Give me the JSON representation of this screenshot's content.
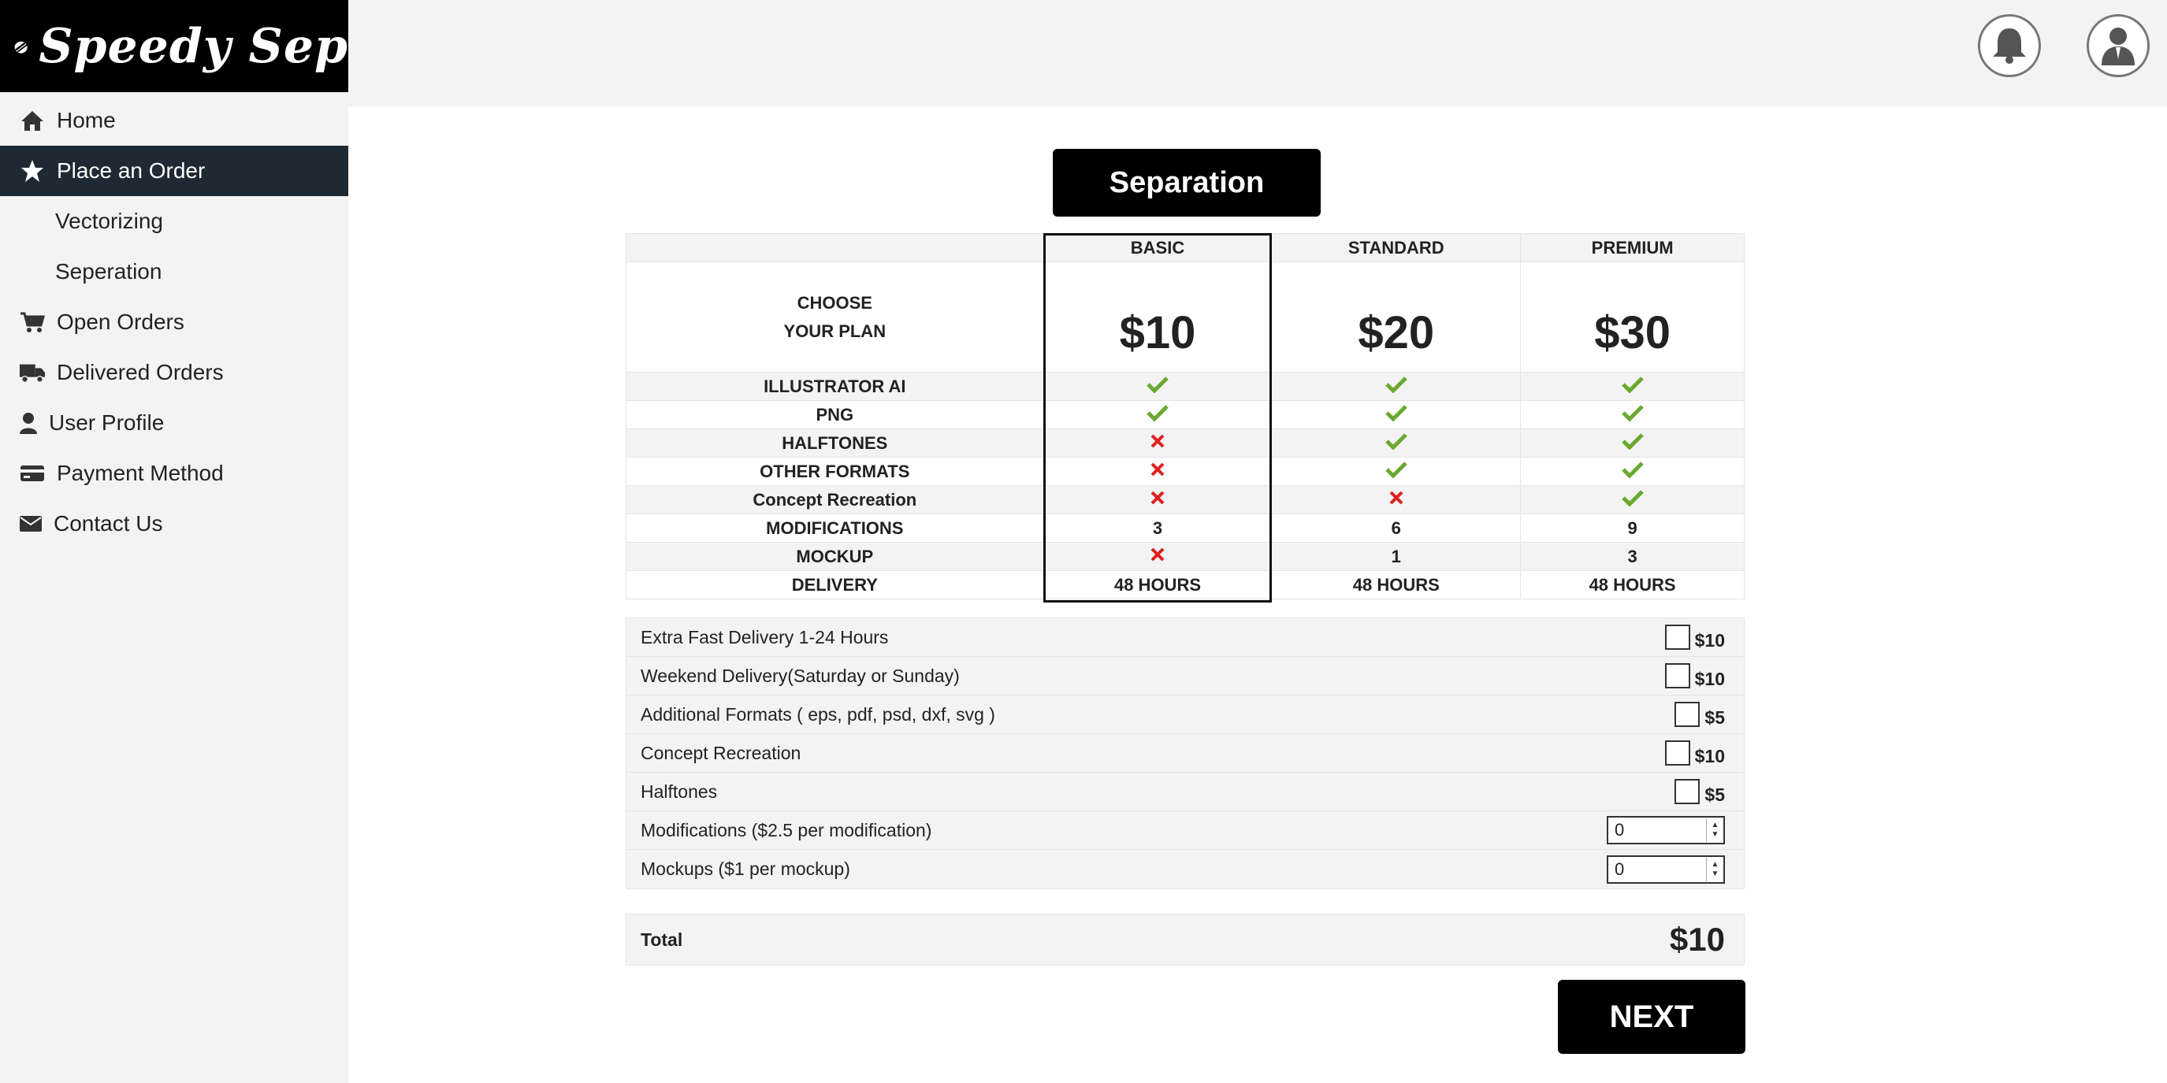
{
  "brand": {
    "name": "Speedy Sep"
  },
  "sidebar": {
    "items": [
      {
        "label": "Home",
        "icon": "home-icon"
      },
      {
        "label": "Place an Order",
        "icon": "star-icon",
        "active": true
      },
      {
        "label": "Vectorizing",
        "sub": true
      },
      {
        "label": "Seperation",
        "sub": true
      },
      {
        "label": "Open Orders",
        "icon": "cart-icon"
      },
      {
        "label": "Delivered Orders",
        "icon": "truck-icon"
      },
      {
        "label": "User Profile",
        "icon": "user-icon"
      },
      {
        "label": "Payment Method",
        "icon": "credit-card-icon"
      },
      {
        "label": "Contact Us",
        "icon": "envelope-icon"
      }
    ]
  },
  "header": {
    "notification_icon": "bell-icon",
    "profile_icon": "user-avatar-icon"
  },
  "page": {
    "title": "Separation"
  },
  "plans": {
    "choose_line1": "CHOOSE",
    "choose_line2": "YOUR PLAN",
    "columns": [
      {
        "name": "BASIC",
        "price": "$10"
      },
      {
        "name": "STANDARD",
        "price": "$20"
      },
      {
        "name": "PREMIUM",
        "price": "$30"
      }
    ],
    "features": [
      {
        "label": "ILLUSTRATOR AI",
        "values": [
          "check",
          "check",
          "check"
        ]
      },
      {
        "label": "PNG",
        "values": [
          "check",
          "check",
          "check"
        ]
      },
      {
        "label": "HALFTONES",
        "values": [
          "cross",
          "check",
          "check"
        ]
      },
      {
        "label": "OTHER FORMATS",
        "values": [
          "cross",
          "check",
          "check"
        ]
      },
      {
        "label": "Concept Recreation",
        "values": [
          "cross",
          "cross",
          "check"
        ]
      },
      {
        "label": "MODIFICATIONS",
        "values": [
          "3",
          "6",
          "9"
        ]
      },
      {
        "label": "MOCKUP",
        "values": [
          "cross",
          "1",
          "3"
        ]
      },
      {
        "label": "DELIVERY",
        "values": [
          "48 HOURS",
          "48 HOURS",
          "48 HOURS"
        ]
      }
    ],
    "selected_plan": "BASIC"
  },
  "extras": {
    "checkbox_options": [
      {
        "label": "Extra Fast Delivery 1-24 Hours",
        "price": "$10",
        "checked": false
      },
      {
        "label": "Weekend Delivery(Saturday or Sunday)",
        "price": "$10",
        "checked": false
      },
      {
        "label": "Additional Formats ( eps, pdf, psd, dxf, svg )",
        "price": "$5",
        "checked": false
      },
      {
        "label": "Concept Recreation",
        "price": "$10",
        "checked": false
      },
      {
        "label": "Halftones",
        "price": "$5",
        "checked": false
      }
    ],
    "number_options": [
      {
        "label": "Modifications ($2.5 per modification)",
        "value": "0"
      },
      {
        "label": "Mockups ($1 per mockup)",
        "value": "0"
      }
    ]
  },
  "total": {
    "label": "Total",
    "value": "$10"
  },
  "next_label": "NEXT",
  "colors": {
    "check": "#6aa92f",
    "cross": "#e01f1f",
    "sidebar_active": "#1f2933",
    "primary_button": "#000000"
  }
}
